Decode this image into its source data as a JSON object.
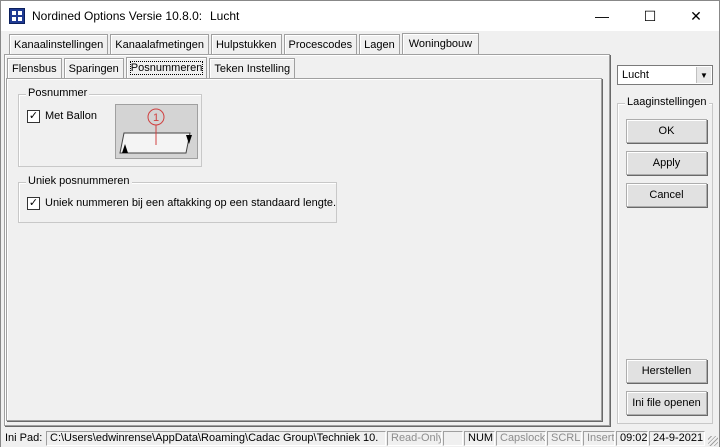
{
  "window": {
    "title": "Nordined Options Versie 10.8.0:",
    "document": "Lucht",
    "minimize": "—",
    "maximize": "☐",
    "close": "✕"
  },
  "tabs_main": [
    {
      "label": "Kanaalinstellingen"
    },
    {
      "label": "Kanaalafmetingen"
    },
    {
      "label": "Hulpstukken"
    },
    {
      "label": "Procescodes"
    },
    {
      "label": "Lagen"
    },
    {
      "label": "Woningbouw"
    }
  ],
  "tabs_sub": [
    {
      "label": "Flensbus"
    },
    {
      "label": "Sparingen"
    },
    {
      "label": "Posnummeren"
    },
    {
      "label": "Teken Instelling"
    }
  ],
  "posnummer": {
    "legend": "Posnummer",
    "met_ballon_label": "Met Ballon",
    "met_ballon_checked": "✓",
    "balloon_number": "1"
  },
  "uniek": {
    "legend": "Uniek posnummeren",
    "checkbox_label": "Uniek nummeren bij een aftakking op een standaard lengte.",
    "checked": "✓"
  },
  "right": {
    "layer_select": "Lucht",
    "group_legend": "Laaginstellingen",
    "ok": "OK",
    "apply": "Apply",
    "cancel": "Cancel",
    "herstellen": "Herstellen",
    "ini_file": "Ini file openen"
  },
  "statusbar": {
    "ini_label": "Ini Pad:",
    "path": "C:\\Users\\edwinrense\\AppData\\Roaming\\Cadac Group\\Techniek 10.",
    "readonly": "Read-Only",
    "num": "NUM",
    "caps": "Capslock",
    "scrl": "SCRL",
    "insert": "Insert",
    "time": "09:02",
    "date": "24-9-2021"
  }
}
